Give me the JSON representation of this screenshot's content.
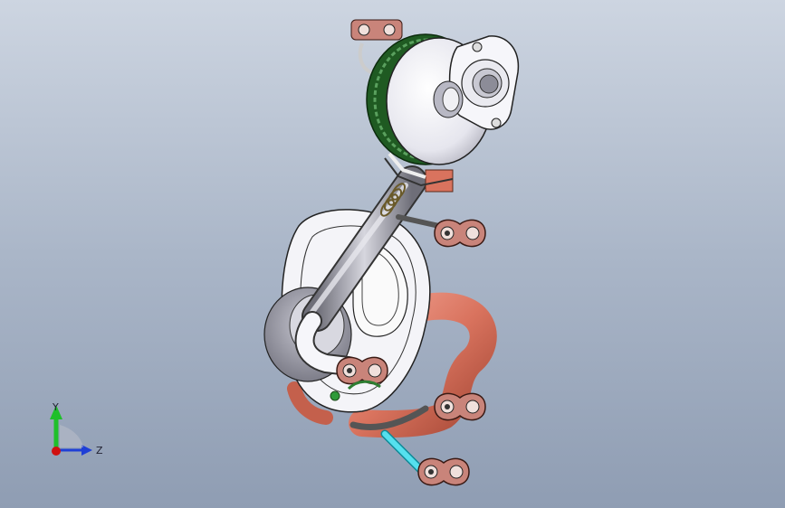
{
  "viewport": {
    "background_top": "#cdd5e1",
    "background_bottom": "#8f9db3"
  },
  "model": {
    "description_colors": {
      "muffler_body": "#f4f4f8",
      "band_green": "#2e7d32",
      "pipe_gray": "#a8a8b0",
      "pipe_copper": "#d9735e",
      "hanger_rubber": "#c9847a",
      "pipe_cyan": "#43d1e0"
    }
  },
  "triad": {
    "y_label": "Y",
    "z_label": "Z",
    "y_color": "#1fbf2a",
    "z_color": "#1f3fd6",
    "origin_color": "#d01010"
  }
}
